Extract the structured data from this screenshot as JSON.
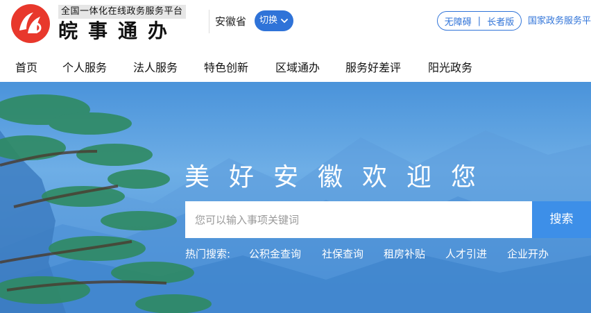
{
  "header": {
    "logo_icon": "anhui-logo-icon",
    "platform_tag": "全国一体化在线政务服务平台",
    "brand_name": "皖事通办",
    "province": "安徽省",
    "switch_label": "切换",
    "accessibility": "无障碍",
    "elder_mode": "长者版",
    "national_link": "国家政务服务平台",
    "brand_color": "#e8382c",
    "accent_color": "#2f73d8"
  },
  "nav": {
    "items": [
      {
        "label": "首页"
      },
      {
        "label": "个人服务"
      },
      {
        "label": "法人服务"
      },
      {
        "label": "特色创新"
      },
      {
        "label": "区域通办"
      },
      {
        "label": "服务好差评"
      },
      {
        "label": "阳光政务"
      }
    ]
  },
  "hero": {
    "welcome": "美好安徽欢迎您",
    "search_placeholder": "您可以输入事项关键词",
    "search_button": "搜索",
    "hot_label": "热门搜索:",
    "hot_items": [
      "公积金查询",
      "社保查询",
      "租房补贴",
      "人才引进",
      "企业开办"
    ]
  }
}
